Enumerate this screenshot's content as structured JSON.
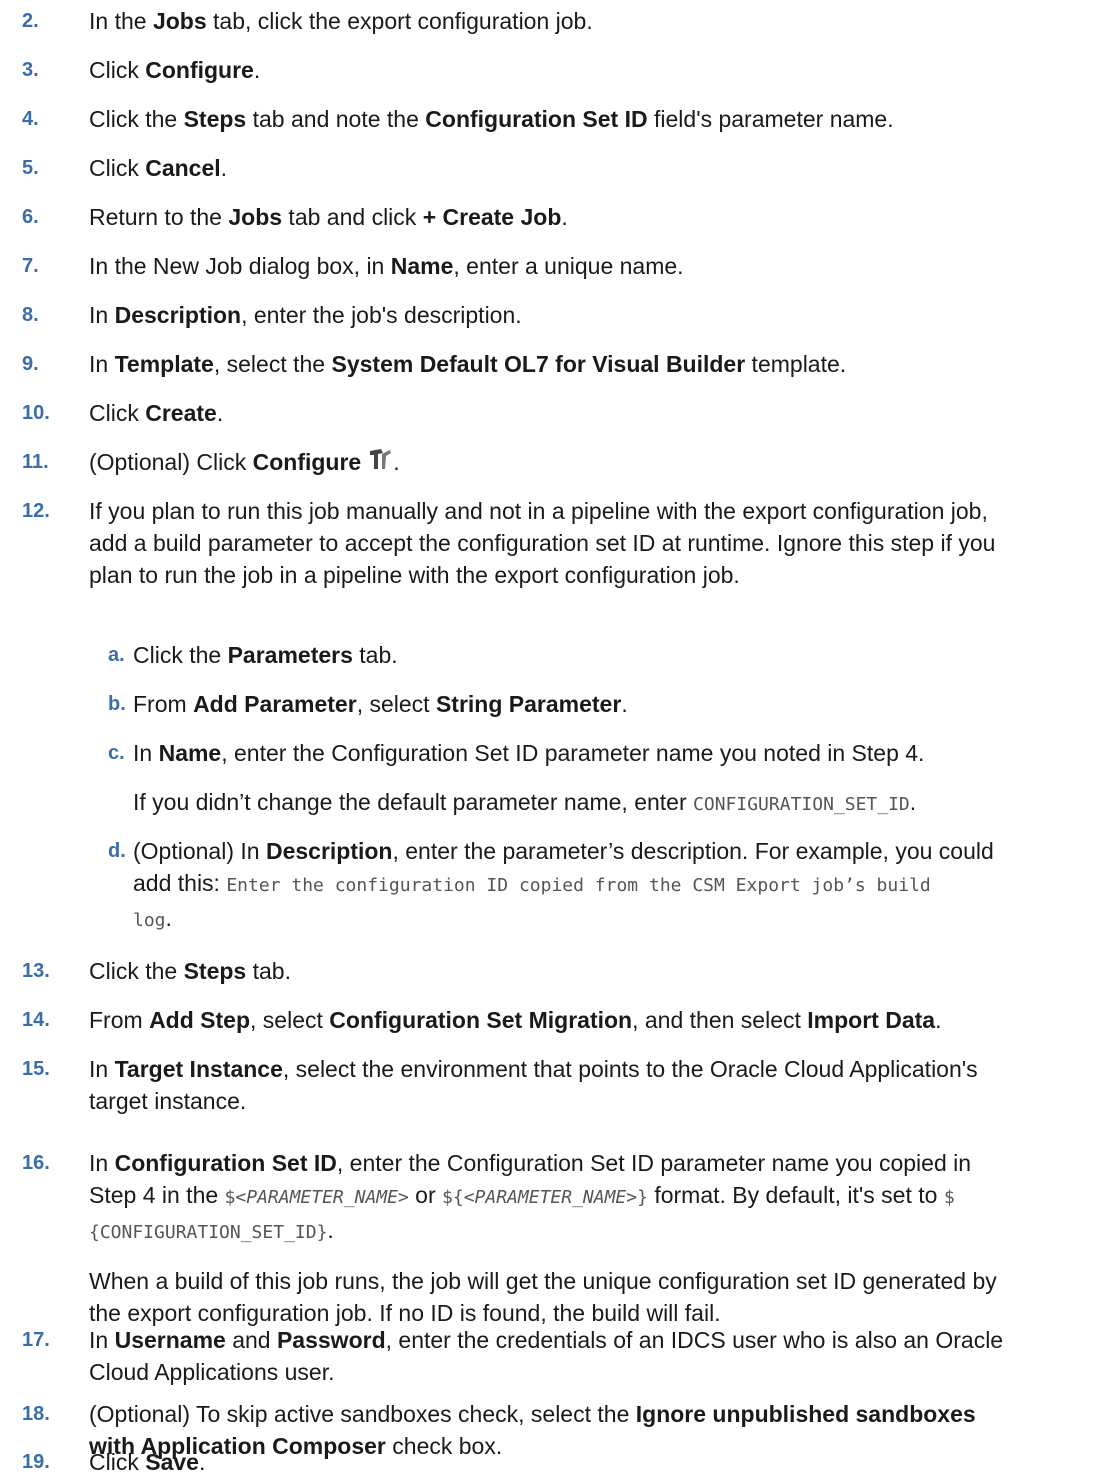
{
  "steps": [
    {
      "num": "2.",
      "parts": [
        {
          "t": "In the "
        },
        {
          "t": "Jobs",
          "b": true
        },
        {
          "t": " tab, click the export configuration job."
        }
      ]
    },
    {
      "num": "3.",
      "parts": [
        {
          "t": "Click "
        },
        {
          "t": "Configure",
          "b": true
        },
        {
          "t": "."
        }
      ]
    },
    {
      "num": "4.",
      "parts": [
        {
          "t": "Click the "
        },
        {
          "t": "Steps",
          "b": true
        },
        {
          "t": " tab and note the "
        },
        {
          "t": "Configuration Set ID",
          "b": true
        },
        {
          "t": " field's parameter name."
        }
      ]
    },
    {
      "num": "5.",
      "parts": [
        {
          "t": "Click "
        },
        {
          "t": "Cancel",
          "b": true
        },
        {
          "t": "."
        }
      ]
    },
    {
      "num": "6.",
      "parts": [
        {
          "t": "Return to the "
        },
        {
          "t": "Jobs",
          "b": true
        },
        {
          "t": " tab and click "
        },
        {
          "t": "+ Create Job",
          "b": true
        },
        {
          "t": "."
        }
      ]
    },
    {
      "num": "7.",
      "parts": [
        {
          "t": "In the New Job dialog box, in "
        },
        {
          "t": "Name",
          "b": true
        },
        {
          "t": ", enter a unique name."
        }
      ]
    },
    {
      "num": "8.",
      "parts": [
        {
          "t": "In "
        },
        {
          "t": "Description",
          "b": true
        },
        {
          "t": ", enter the job's description."
        }
      ]
    },
    {
      "num": "9.",
      "parts": [
        {
          "t": "In "
        },
        {
          "t": "Template",
          "b": true
        },
        {
          "t": ", select the "
        },
        {
          "t": "System Default OL7 for Visual Builder",
          "b": true
        },
        {
          "t": " template."
        }
      ]
    },
    {
      "num": "10.",
      "parts": [
        {
          "t": "Click "
        },
        {
          "t": "Create",
          "b": true
        },
        {
          "t": "."
        }
      ]
    },
    {
      "num": "11.",
      "parts": [
        {
          "t": "(Optional) Click "
        },
        {
          "t": "Configure",
          "b": true
        },
        {
          "icon": "hammer-icon"
        },
        {
          "t": "."
        }
      ]
    },
    {
      "num": "12.",
      "lines": [
        [
          {
            "t": "If you plan to run this job manually and not in a pipeline with the export configuration job,"
          }
        ],
        [
          {
            "t": "add a build parameter to accept the configuration set ID at runtime. Ignore this step if you"
          }
        ],
        [
          {
            "t": "plan to run the job in a pipeline with the export configuration job."
          }
        ]
      ]
    },
    {
      "num": "a.",
      "sub": true,
      "parts": [
        {
          "t": "Click the "
        },
        {
          "t": "Parameters",
          "b": true
        },
        {
          "t": " tab."
        }
      ]
    },
    {
      "num": "b.",
      "sub": true,
      "parts": [
        {
          "t": "From "
        },
        {
          "t": "Add Parameter",
          "b": true
        },
        {
          "t": ", select "
        },
        {
          "t": "String Parameter",
          "b": true
        },
        {
          "t": "."
        }
      ]
    },
    {
      "num": "c.",
      "sub": true,
      "parts": [
        {
          "t": "In "
        },
        {
          "t": "Name",
          "b": true
        },
        {
          "t": ", enter the Configuration Set ID parameter name you noted in Step 4."
        }
      ]
    },
    {
      "num": "",
      "sub": true,
      "note": true,
      "parts": [
        {
          "t": "If you didn’t change the default parameter name, enter "
        },
        {
          "t": "CONFIGURATION_SET_ID",
          "m": true
        },
        {
          "t": "."
        }
      ]
    },
    {
      "num": "d.",
      "sub": true,
      "lines": [
        [
          {
            "t": "(Optional) In "
          },
          {
            "t": "Description",
            "b": true
          },
          {
            "t": ", enter the parameter’s description. For example, you could"
          }
        ],
        [
          {
            "t": "add this: "
          },
          {
            "t": "Enter the configuration ID copied from the CSM Export job’s build",
            "m": true
          }
        ],
        [
          {
            "t": "log",
            "m": true
          },
          {
            "t": "."
          }
        ]
      ]
    },
    {
      "num": "13.",
      "parts": [
        {
          "t": "Click the "
        },
        {
          "t": "Steps",
          "b": true
        },
        {
          "t": " tab."
        }
      ]
    },
    {
      "num": "14.",
      "parts": [
        {
          "t": "From "
        },
        {
          "t": "Add Step",
          "b": true
        },
        {
          "t": ", select "
        },
        {
          "t": "Configuration Set Migration",
          "b": true
        },
        {
          "t": ", and then select "
        },
        {
          "t": "Import Data",
          "b": true
        },
        {
          "t": "."
        }
      ]
    },
    {
      "num": "15.",
      "lines": [
        [
          {
            "t": "In "
          },
          {
            "t": "Target Instance",
            "b": true
          },
          {
            "t": ", select the environment that points to the Oracle Cloud Application's"
          }
        ],
        [
          {
            "t": "target instance."
          }
        ]
      ]
    },
    {
      "num": "16.",
      "lines": [
        [
          {
            "t": "In "
          },
          {
            "t": "Configuration Set ID",
            "b": true
          },
          {
            "t": ", enter the Configuration Set ID parameter name you copied in"
          }
        ],
        [
          {
            "t": "Step 4 in the "
          },
          {
            "t": "$<",
            "m": true
          },
          {
            "t": "PARAMETER_NAME",
            "mi": true
          },
          {
            "t": ">",
            "m": true
          },
          {
            "t": " or "
          },
          {
            "t": "${<",
            "m": true
          },
          {
            "t": "PARAMETER_NAME",
            "mi": true
          },
          {
            "t": ">}",
            "m": true
          },
          {
            "t": " format. By default, it's set to "
          },
          {
            "t": "$",
            "m": true
          }
        ],
        [
          {
            "t": "{CONFIGURATION_SET_ID}",
            "m": true
          },
          {
            "t": "."
          }
        ]
      ]
    },
    {
      "num": "",
      "note": true,
      "lines": [
        [
          {
            "t": "When a build of this job runs, the job will get the unique configuration set ID generated by"
          }
        ],
        [
          {
            "t": "the export configuration job. If no ID is found, the build will fail."
          }
        ]
      ]
    },
    {
      "num": "17.",
      "lines": [
        [
          {
            "t": "In "
          },
          {
            "t": "Username",
            "b": true
          },
          {
            "t": " and "
          },
          {
            "t": "Password",
            "b": true
          },
          {
            "t": ", enter the credentials of an IDCS user who is also an Oracle"
          }
        ],
        [
          {
            "t": "Cloud Applications user."
          }
        ]
      ]
    },
    {
      "num": "18.",
      "lines": [
        [
          {
            "t": "(Optional) To skip active sandboxes check, select the "
          },
          {
            "t": "Ignore unpublished sandboxes",
            "b": true
          }
        ],
        [
          {
            "t": "with Application Composer",
            "b": true
          },
          {
            "t": " check box."
          }
        ]
      ]
    },
    {
      "num": "19.",
      "parts": [
        {
          "t": "Click "
        },
        {
          "t": "Save",
          "b": true
        },
        {
          "t": "."
        }
      ]
    }
  ]
}
